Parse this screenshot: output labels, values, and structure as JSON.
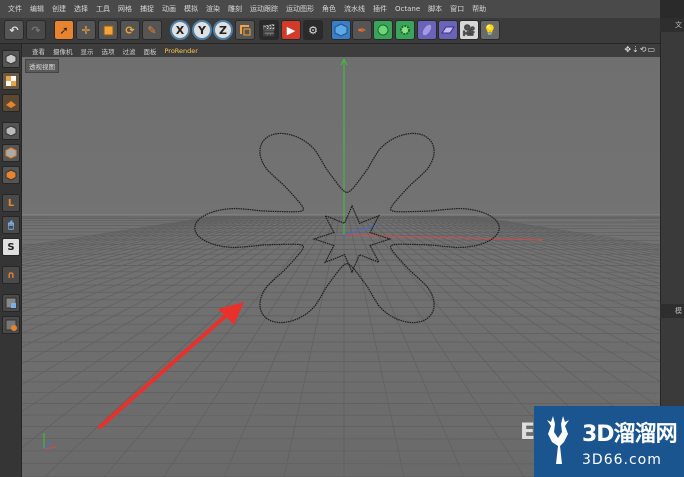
{
  "menubar": {
    "items": [
      "文件",
      "编辑",
      "创建",
      "选择",
      "工具",
      "网格",
      "捕捉",
      "动画",
      "模拟",
      "渲染",
      "雕刻",
      "运动跟踪",
      "运动图形",
      "角色",
      "流水线",
      "插件",
      "Octane",
      "脚本",
      "窗口",
      "帮助"
    ]
  },
  "toolbar": {
    "axis_x": "X",
    "axis_y": "Y",
    "axis_z": "Z"
  },
  "viewport_menu": {
    "items": [
      "查看",
      "摄像机",
      "显示",
      "选项",
      "过滤",
      "面板"
    ],
    "prorender": "ProRender"
  },
  "viewport": {
    "label": "透视视图"
  },
  "right_panel": {
    "tab_top": "文",
    "tab_mid": "模"
  },
  "watermark": {
    "line1": "3D溜溜网",
    "line2": "3D66.com",
    "behind_text": "E"
  },
  "colors": {
    "viewport_bg": "#6b6b6b",
    "grid_line": "#5a5a5a",
    "y_axis": "#3fbf3f",
    "x_axis": "#d24a4a",
    "arrow": "#e8312b",
    "watermark_bg": "#1a5590",
    "accent": "#ffc84a"
  }
}
